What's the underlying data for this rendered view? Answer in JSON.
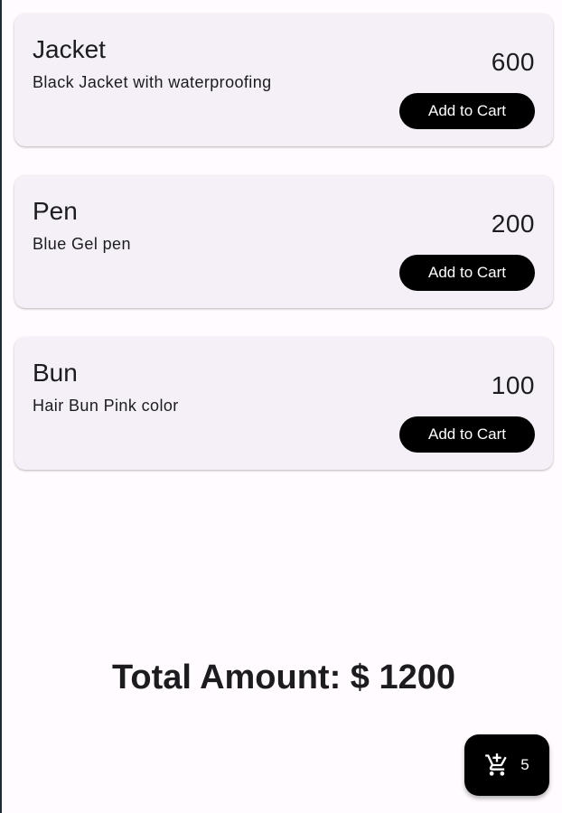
{
  "products": [
    {
      "name": "Jacket",
      "description": "Black Jacket with waterproofing",
      "price": "600",
      "button_label": "Add to Cart"
    },
    {
      "name": "Pen",
      "description": "Blue Gel pen",
      "price": "200",
      "button_label": "Add to Cart"
    },
    {
      "name": "Bun",
      "description": "Hair Bun Pink color",
      "price": "100",
      "button_label": "Add to Cart"
    }
  ],
  "total": {
    "label": "Total Amount: $ 1200"
  },
  "cart": {
    "icon": "add-shopping-cart-icon",
    "count": "5"
  },
  "colors": {
    "background": "#fffbfe",
    "card": "#f5f0f8",
    "button": "#000000",
    "button_text": "#ffffff"
  }
}
